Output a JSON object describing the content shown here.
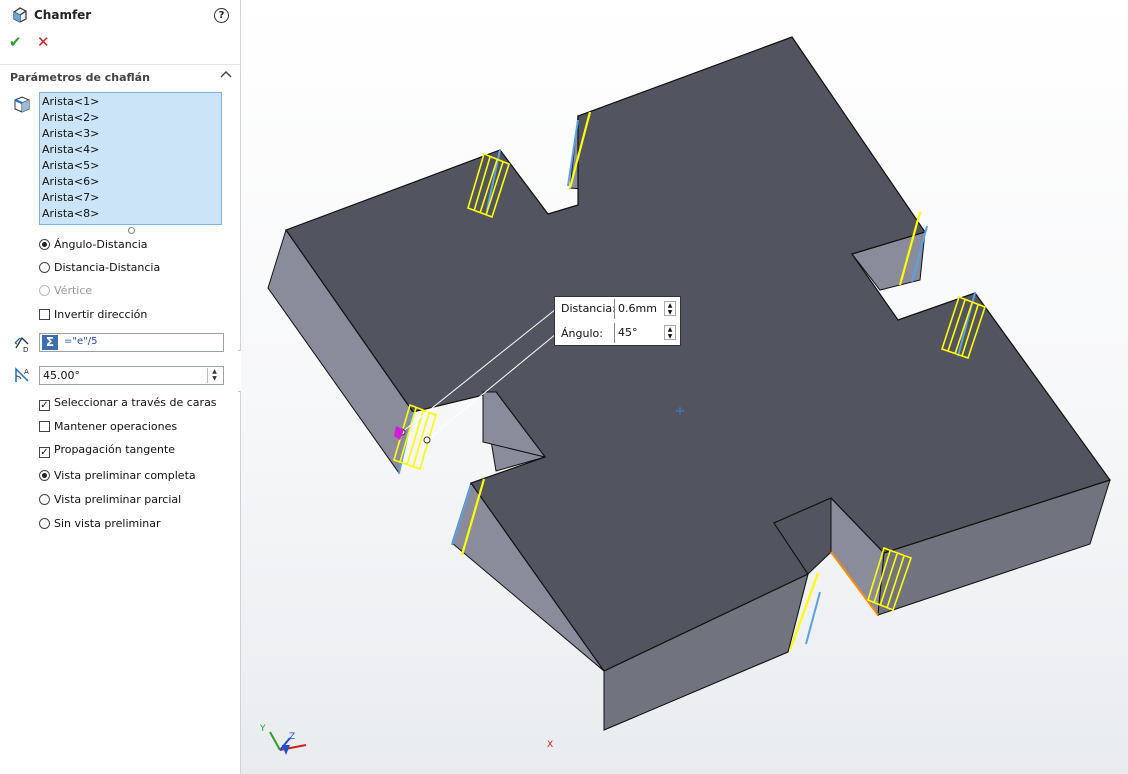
{
  "panel": {
    "title": "Chamfer",
    "help_icon": "?",
    "ok_icon": "✔",
    "cancel_icon": "✕",
    "section_title": "Parámetros de chaflán",
    "edges": [
      "Arista<1>",
      "Arista<2>",
      "Arista<3>",
      "Arista<4>",
      "Arista<5>",
      "Arista<6>",
      "Arista<7>",
      "Arista<8>"
    ],
    "chamfer_types": {
      "angle_distance": "Ángulo-Distancia",
      "distance_distance": "Distancia-Distancia",
      "vertex": "Vértice"
    },
    "selected_type": "angle_distance",
    "flip_direction": "Invertir dirección",
    "distance_equation": "=\"e\"/5",
    "angle_value": "45.00°",
    "options": {
      "select_through_faces": "Seleccionar a través de caras",
      "keep_features": "Mantener operaciones",
      "tangent_propagation": "Propagación tangente"
    },
    "checks": {
      "select_through_faces": true,
      "keep_features": false,
      "tangent_propagation": true,
      "flip_direction": false
    },
    "preview": {
      "full": "Vista preliminar completa",
      "partial": "Vista preliminar parcial",
      "none": "Sin vista preliminar"
    },
    "selected_preview": "full"
  },
  "callout": {
    "distance_label": "Distancia:",
    "distance_value": "0.6mm",
    "angle_label": "Ángulo:",
    "angle_value": "45°"
  },
  "triad": {
    "x": "X",
    "y": "Y",
    "z": "Z"
  },
  "colors": {
    "top_face": "#52545f",
    "side_face": "#8a8c9c",
    "edge_highlight": "#ffff00",
    "edge_select": "#5aa0e6"
  }
}
